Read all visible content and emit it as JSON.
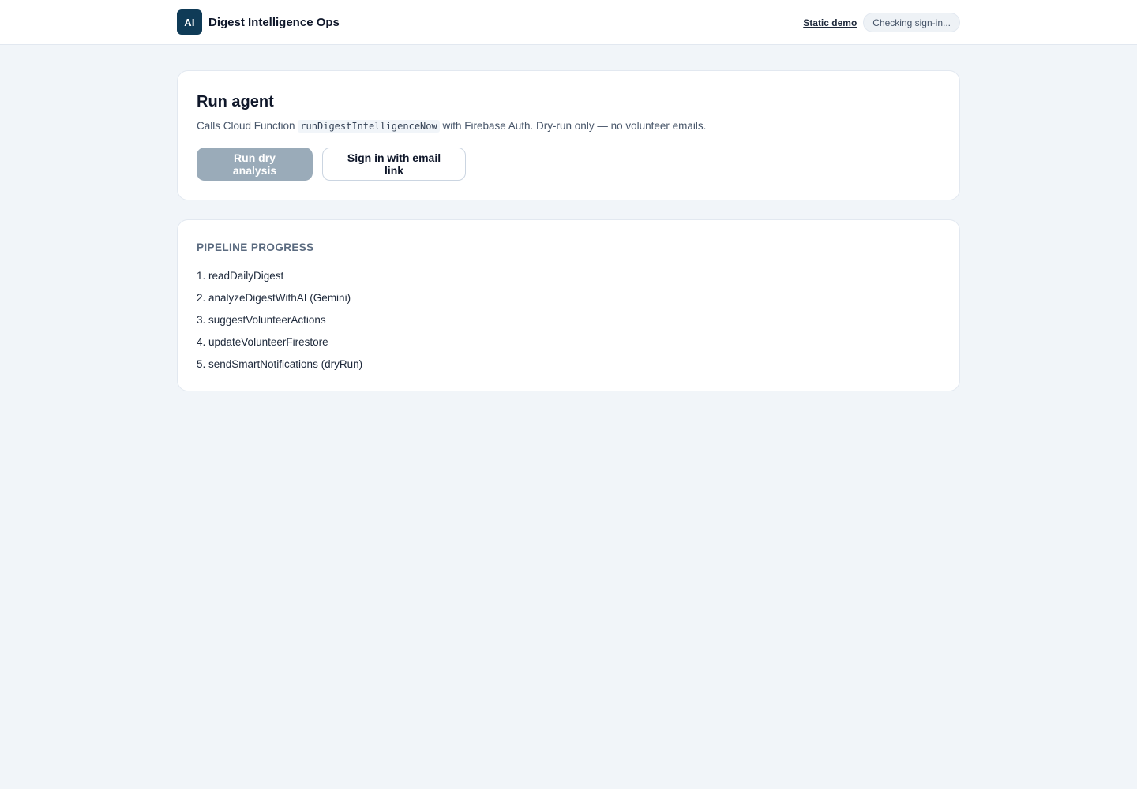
{
  "header": {
    "logo_text": "AI",
    "app_title": "Digest Intelligence Ops",
    "demo_link": "Static demo",
    "auth_status": "Checking sign-in..."
  },
  "run_card": {
    "title": "Run agent",
    "desc_prefix": "Calls Cloud Function",
    "function_name": "runDigestIntelligenceNow",
    "desc_suffix": "with Firebase Auth. Dry-run only — no volunteer emails.",
    "run_button": "Run dry analysis",
    "signin_button": "Sign in with email link"
  },
  "pipeline": {
    "label": "PIPELINE PROGRESS",
    "steps": [
      "1. readDailyDigest",
      "2. analyzeDigestWithAI (Gemini)",
      "3. suggestVolunteerActions",
      "4. updateVolunteerFirestore",
      "5. sendSmartNotifications (dryRun)"
    ]
  },
  "colors": {
    "background": "#f1f5f9",
    "logo": "#0f3b57",
    "disabled_button": "#9aabb9"
  }
}
